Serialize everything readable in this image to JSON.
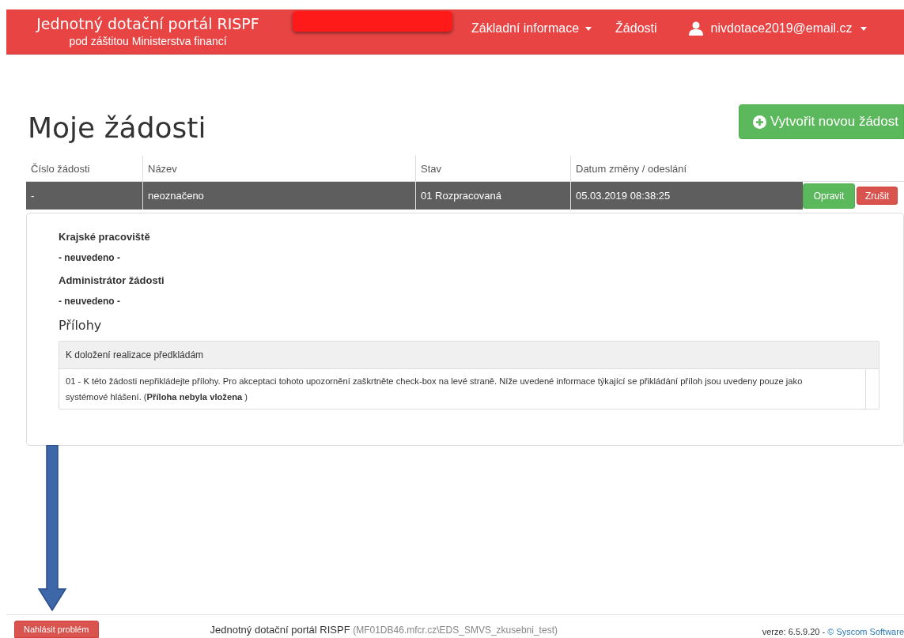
{
  "header": {
    "title": "Jednotný dotační portál RISPF",
    "subtitle": "pod záštitou Ministerstva financí",
    "nav": [
      {
        "label": "Základní informace",
        "dropdown": true
      },
      {
        "label": "Žádosti",
        "dropdown": false
      }
    ],
    "user": {
      "email": "nivdotace2019@email.cz",
      "dropdown": true
    }
  },
  "page_title": "Moje žádosti",
  "create_button": "Vytvořit novou žádost",
  "table": {
    "columns": [
      "Číslo žádosti",
      "Název",
      "Stav",
      "Datum změny / odeslání"
    ],
    "rows": [
      {
        "cells": [
          "-",
          "neoznačeno",
          "01 Rozpracovaná",
          "05.03.2019 08:38:25"
        ],
        "actions": [
          {
            "label": "Opravit",
            "kind": "edit"
          },
          {
            "label": "Zrušit",
            "kind": "cancel"
          }
        ]
      }
    ]
  },
  "detail": {
    "fields": [
      {
        "label": "Krajské pracoviště",
        "value": "- neuvedeno -"
      },
      {
        "label": "Administrátor žádosti",
        "value": "- neuvedeno -"
      }
    ],
    "attachments_title": "Přílohy",
    "attachments": {
      "heading": "K doložení realizace předkládám",
      "items": [
        {
          "text": "01 - K této žádosti nepřikládejte přílohy. Pro akceptaci tohoto upozornění zaškrtněte check-box na levé straně. Níže uvedené informace týkající se přikládání příloh jsou uvedeny pouze jako systémové hlášení. (**Příloha nebyla vložena** )"
        }
      ]
    }
  },
  "footer": {
    "report_button": "Nahlásit problém",
    "app_name": "Jednotný dotační portál RISPF",
    "server": "(MF01DB46.mfcr.cz\\EDS_SMVS_zkusebni_test)",
    "version": "verze: 6.5.9.20 - ",
    "copyright": "© Syscom Software"
  }
}
